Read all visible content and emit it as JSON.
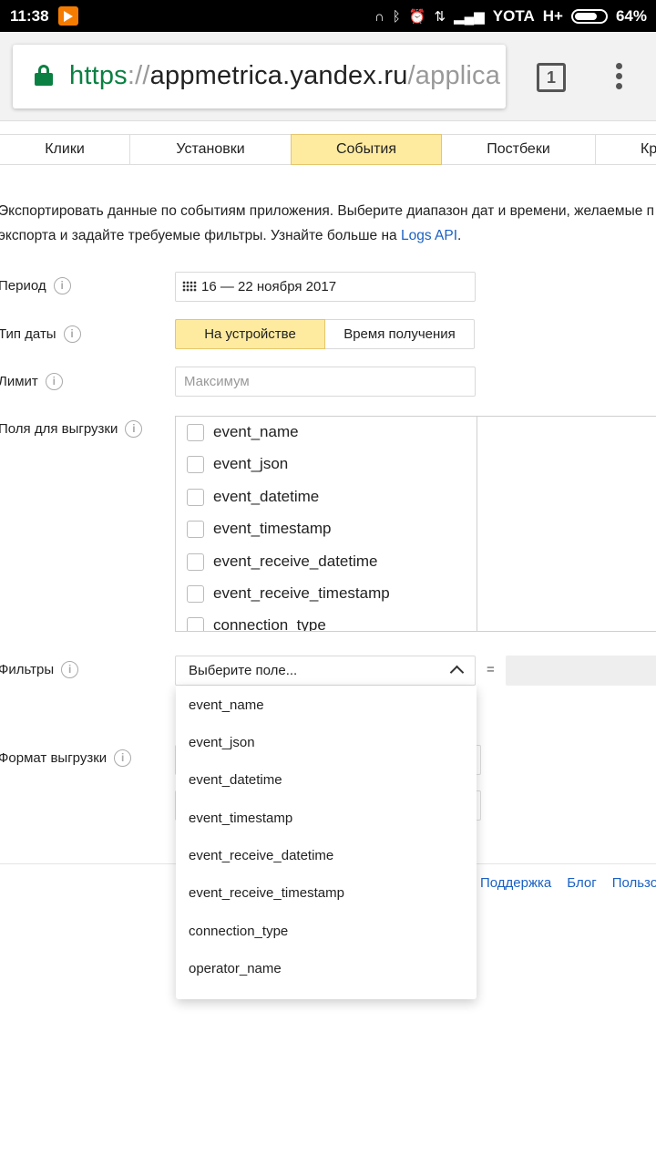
{
  "status": {
    "time": "11:38",
    "carrier": "YOTA",
    "network": "H+",
    "battery": "64%"
  },
  "browser": {
    "url_scheme": "https",
    "url_sep": "://",
    "url_host": "appmetrica.yandex.ru",
    "url_path": "/applica",
    "tab_count": "1"
  },
  "tabs": [
    "Клики",
    "Установки",
    "События",
    "Постбеки",
    "Кр"
  ],
  "description": {
    "line1": "Экспортировать данные по событиям приложения. Выберите диапазон дат и времени, желаемые п",
    "line2": "экспорта и задайте требуемые фильтры. Узнайте больше на ",
    "link": "Logs API",
    "tail": "."
  },
  "form": {
    "period_label": "Период",
    "period_value": "16 — 22 ноября 2017",
    "date_type_label": "Тип даты",
    "date_type_on": "На устройстве",
    "date_type_off": "Время получения",
    "limit_label": "Лимит",
    "limit_placeholder": "Максимум",
    "fields_label": "Поля для выгрузки",
    "fields": [
      "event_name",
      "event_json",
      "event_datetime",
      "event_timestamp",
      "event_receive_datetime",
      "event_receive_timestamp",
      "connection_type"
    ],
    "filters_label": "Фильтры",
    "filter_select": "Выберите поле...",
    "filter_eq": "=",
    "format_label": "Формат выгрузки"
  },
  "dropdown": [
    "event_name",
    "event_json",
    "event_datetime",
    "event_timestamp",
    "event_receive_datetime",
    "event_receive_timestamp",
    "connection_type",
    "operator_name"
  ],
  "footer": {
    "support": "Поддержка",
    "blog": "Блог",
    "user": "Пользо"
  },
  "icons": {
    "info": "info-icon",
    "calendar": "calendar-icon",
    "lock": "lock-icon",
    "menu": "overflow-menu-icon"
  },
  "colors": {
    "active_tab": "#ffeba0",
    "link": "#1a61c4",
    "secure": "#0b8043"
  }
}
